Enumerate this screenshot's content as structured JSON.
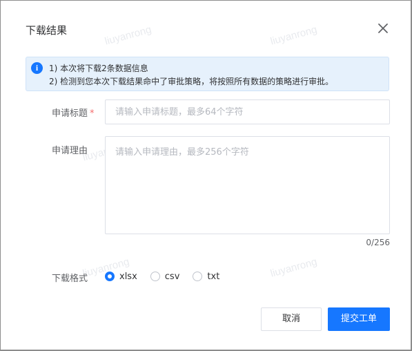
{
  "dialog": {
    "title": "下载结果",
    "close_icon": "close-icon"
  },
  "alert": {
    "icon": "info-icon",
    "line1": "1) 本次将下载2条数据信息",
    "line2": "2) 检测到您本次下载结果命中了审批策略，将按照所有数据的策略进行审批。"
  },
  "form": {
    "title_label": "申请标题",
    "title_required_mark": "*",
    "title_value": "",
    "title_placeholder": "请输入申请标题，最多64个字符",
    "reason_label": "申请理由",
    "reason_value": "",
    "reason_placeholder": "请输入申请理由，最多256个字符",
    "reason_counter": "0/256",
    "format_label": "下载格式",
    "formats": [
      {
        "label": "xlsx",
        "checked": true
      },
      {
        "label": "csv",
        "checked": false
      },
      {
        "label": "txt",
        "checked": false
      }
    ]
  },
  "footer": {
    "cancel_label": "取消",
    "submit_label": "提交工单"
  },
  "watermark": {
    "text": "liuyanrong"
  },
  "colors": {
    "primary": "#1677ff",
    "alert_bg": "#e6f1fc",
    "required": "#f56c6c"
  }
}
